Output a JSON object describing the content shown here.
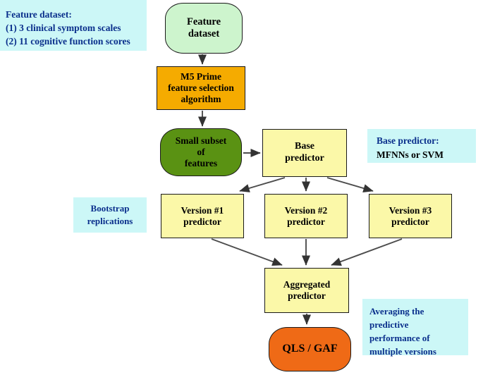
{
  "diagram": {
    "title": "Bootstrap aggregation prediction flowchart",
    "colors": {
      "feature_dataset_fill": "#cdf4cd",
      "m5prime_fill": "#f5ab00",
      "small_subset_fill": "#5a9213",
      "predictor_fill": "#fbf8a8",
      "output_fill": "#ef6a16",
      "callout_fill": "#ccf7f7",
      "callout_text": "#0a2f8c",
      "edge_stroke": "#404040"
    }
  },
  "nodes": {
    "feature_dataset": {
      "line1": "Feature",
      "line2": "dataset"
    },
    "m5prime": {
      "line1": "M5 Prime",
      "line2": "feature selection",
      "line3": "algorithm"
    },
    "small_subset": {
      "line1": "Small subset",
      "line2": "of",
      "line3": "features"
    },
    "base_predictor": {
      "line1": "Base",
      "line2": "predictor"
    },
    "version1": {
      "line1": "Version #1",
      "line2": "predictor"
    },
    "version2": {
      "line1": "Version #2",
      "line2": "predictor"
    },
    "version3": {
      "line1": "Version #3",
      "line2": "predictor"
    },
    "aggregated": {
      "line1": "Aggregated",
      "line2": "predictor"
    },
    "qls_gaf": {
      "line1": "QLS  /  GAF"
    }
  },
  "callouts": {
    "feature_dataset": {
      "line1": "Feature dataset:",
      "line2": "(1) 3 clinical  symptom  scales",
      "line3": "(2) 11 cognitive  function  scores"
    },
    "base_predictor": {
      "line1": "Base predictor:",
      "line2": "MFNNs or SVM"
    },
    "bootstrap": {
      "line1": "Bootstrap",
      "line2": "replications"
    },
    "averaging": {
      "line1": "Averaging  the",
      "line2": "predictive",
      "line3": "performance  of",
      "line4": "multiple  versions"
    }
  }
}
